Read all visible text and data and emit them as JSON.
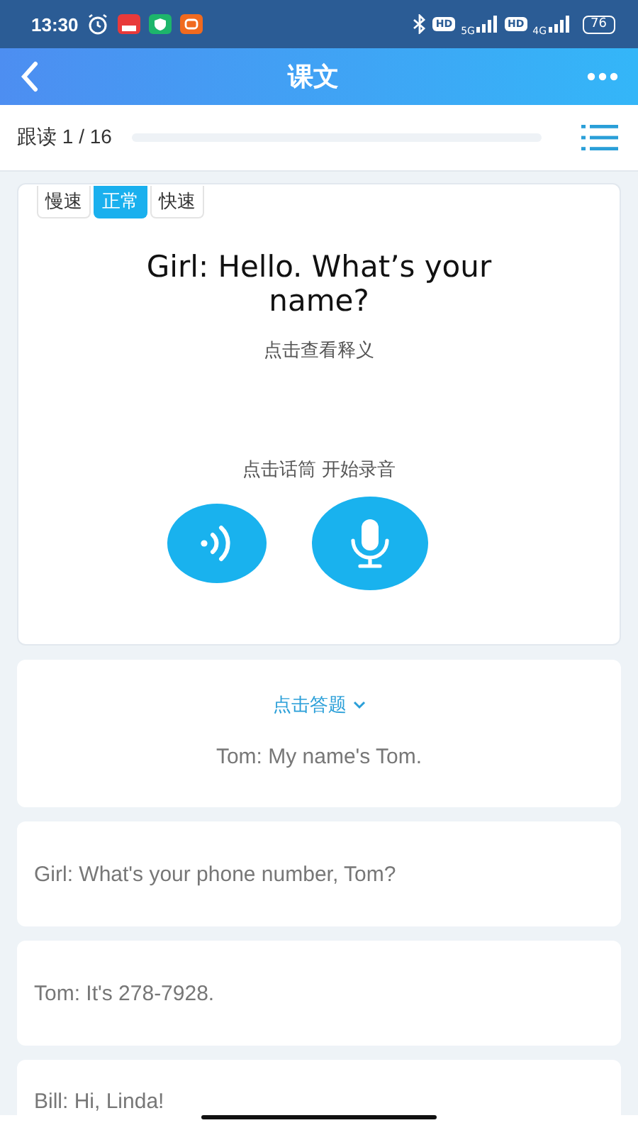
{
  "status_bar": {
    "time": "13:30",
    "hd_1": "HD",
    "network_1": "5G",
    "hd_2": "HD",
    "network_2": "4G",
    "battery": "76"
  },
  "header": {
    "title": "课文"
  },
  "progress": {
    "label": "跟读 1 / 16"
  },
  "speeds": [
    {
      "label": "慢速",
      "selected": false
    },
    {
      "label": "正常",
      "selected": true
    },
    {
      "label": "快速",
      "selected": false
    }
  ],
  "current": {
    "sentence": "Girl: Hello. What’s your name?",
    "hint": "点击查看释义",
    "record_hint": "点击话筒 开始录音"
  },
  "answer_card": {
    "prompt": "点击答题",
    "sentence": "Tom: My name's Tom."
  },
  "lines": [
    "Girl: What's your phone number, Tom?",
    "Tom: It's 278-7928.",
    "Bill: Hi, Linda!"
  ]
}
